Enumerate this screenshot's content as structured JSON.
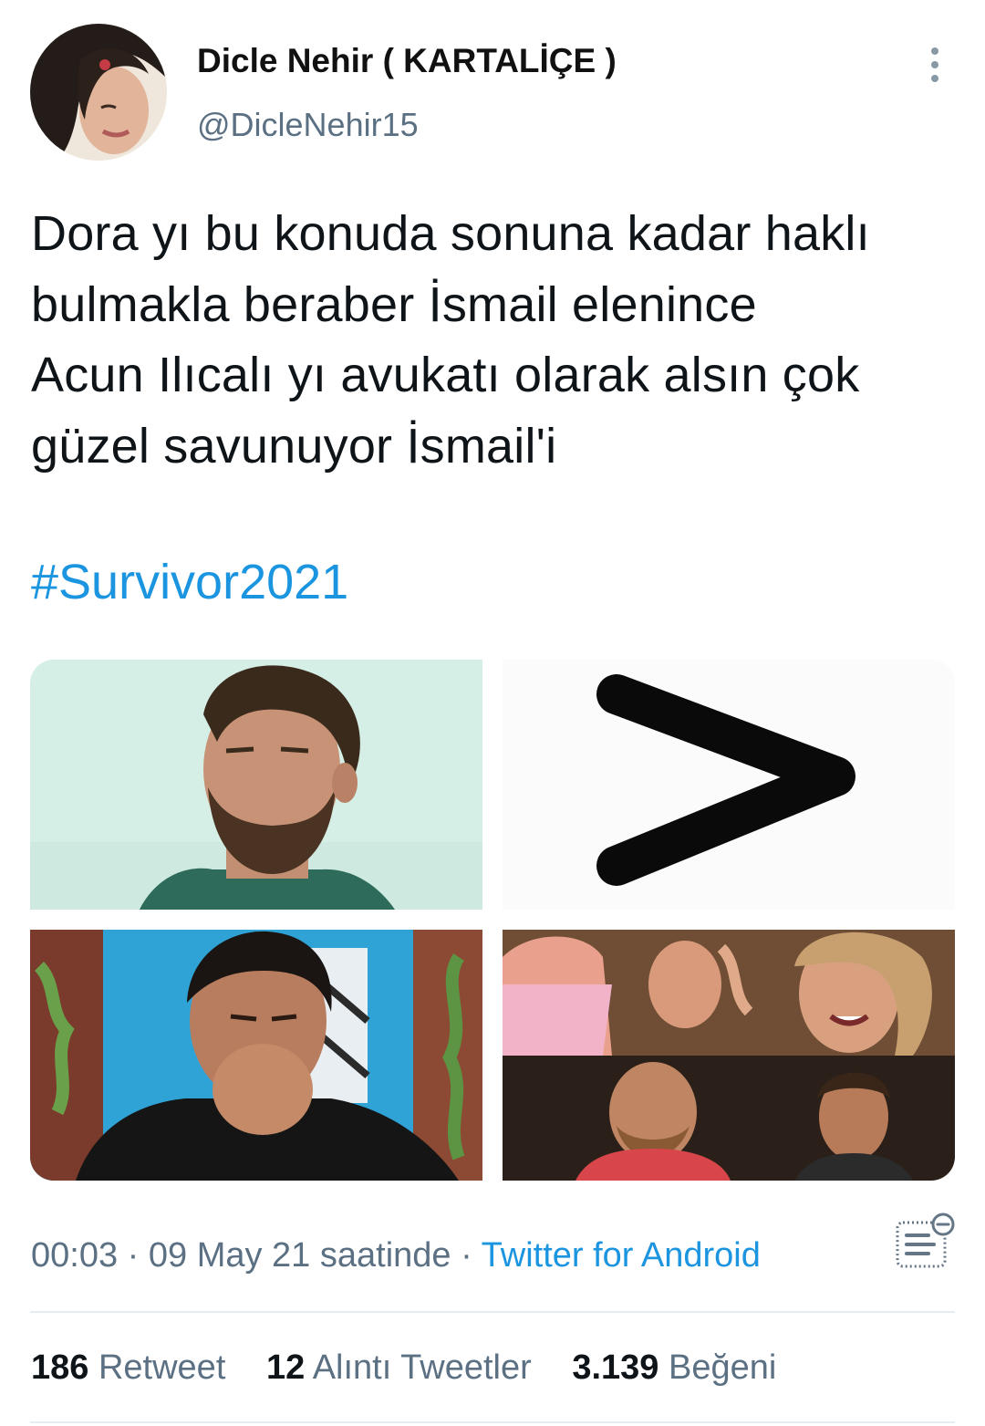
{
  "author": {
    "display_name": "Dicle Nehir ( KARTALİÇE )",
    "handle": "@DicleNehir15"
  },
  "tweet": {
    "text": "Dora yı bu konuda sonuna kadar haklı\nbulmakla beraber İsmail elenince\nAcun Ilıcalı yı avukatı olarak alsın çok\ngüzel savunuyor İsmail'i",
    "hashtag": "#Survivor2021"
  },
  "media": {
    "images": [
      "bearded-man-photo",
      "greater-than-symbol",
      "man-drinking-photo",
      "laughing-contestants-photo"
    ]
  },
  "meta": {
    "time": "00:03",
    "separator1": " · ",
    "date": "09 May 21 saatinde",
    "separator2": " · ",
    "source": "Twitter for Android"
  },
  "stats": {
    "retweets_count": "186",
    "retweets_label": "Retweet",
    "quotes_count": "12",
    "quotes_label": "Alıntı Tweetler",
    "likes_count": "3.139",
    "likes_label": "Beğeni"
  },
  "colors": {
    "link": "#1b95e0",
    "secondary_text": "#5b7083",
    "divider": "#e6ecf0"
  },
  "icons": {
    "more": "vertical-ellipsis-icon",
    "analytics": "tweet-activity-icon"
  }
}
